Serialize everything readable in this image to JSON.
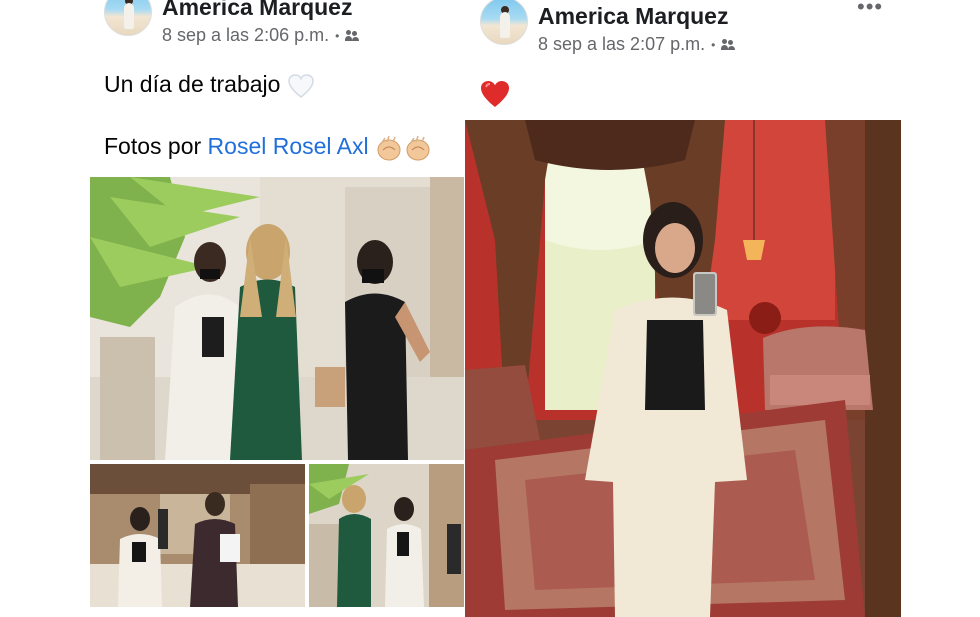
{
  "posts": [
    {
      "author": "America Marquez",
      "timestamp": "8 sep a las 2:06 p.m.",
      "separator": "•",
      "audience_icon": "friends-icon",
      "line1": "Un día de trabajo",
      "line1_emoji": "white-heart",
      "line2_prefix": "Fotos por",
      "line2_link": "Rosel Rosel Axl",
      "line2_emoji": "clapping-hands",
      "photos": [
        "photo-three-women-courtyard",
        "photo-woman-man-walking",
        "photo-group-hallway"
      ]
    },
    {
      "author": "America Marquez",
      "timestamp": "8 sep a las 2:07 p.m.",
      "separator": "•",
      "audience_icon": "friends-icon",
      "more_label": "•••",
      "reaction_emoji": "red-heart",
      "photos": [
        "photo-mirror-selfie-red-room"
      ]
    }
  ]
}
